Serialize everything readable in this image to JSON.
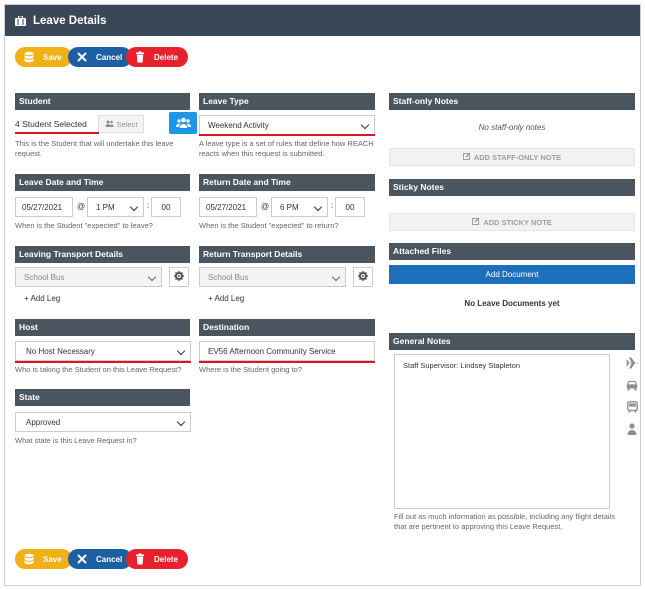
{
  "window": {
    "title": "Leave Details"
  },
  "actions": {
    "save": "Save",
    "cancel": "Cancel",
    "delete": "Delete"
  },
  "student": {
    "header": "Student",
    "value": "4 Student Selected",
    "select_label": "Select",
    "hint": "This is the Student that will undertake this leave request."
  },
  "leave_type": {
    "header": "Leave Type",
    "value": "Weekend Activity",
    "hint": "A leave type is a set of rules that define how REACH reacts when this request is submitted."
  },
  "leave_datetime": {
    "header": "Leave Date and Time",
    "date": "05/27/2021",
    "at": "@",
    "hour": "1 PM",
    "sep": ":",
    "minute": "00",
    "hint": "When is the Student \"expected\" to leave?"
  },
  "return_datetime": {
    "header": "Return Date and Time",
    "date": "05/27/2021",
    "at": "@",
    "hour": "6 PM",
    "sep": ":",
    "minute": "00",
    "hint": "When is the Student \"expected\" to return?"
  },
  "leaving_transport": {
    "header": "Leaving Transport Details",
    "value": "School Bus",
    "add_leg": "+ Add Leg"
  },
  "return_transport": {
    "header": "Return Transport Details",
    "value": "School Bus",
    "add_leg": "+ Add Leg"
  },
  "host": {
    "header": "Host",
    "value": "No Host Necessary",
    "hint": "Who is taking the Student on this Leave Request?"
  },
  "destination": {
    "header": "Destination",
    "value": "EV56 Afternoon Community Service",
    "hint": "Where is the Student going to?"
  },
  "state": {
    "header": "State",
    "value": "Approved",
    "hint": "What state is this Leave Request in?"
  },
  "staff_notes": {
    "header": "Staff-only Notes",
    "empty": "No staff-only notes",
    "add": "ADD STAFF-ONLY NOTE"
  },
  "sticky_notes": {
    "header": "Sticky Notes",
    "add": "ADD STICKY NOTE"
  },
  "attached_files": {
    "header": "Attached Files",
    "add": "Add Document",
    "empty": "No Leave Documents yet"
  },
  "general_notes": {
    "header": "General Notes",
    "content": "Staff Supervisor: Lindsey Stapleton",
    "hint": "Fill out as much information as possible, including any flight details that are pertinent to approving this Leave Request."
  },
  "side_icons": [
    "plane-icon",
    "car-icon",
    "bus-icon",
    "person-icon"
  ],
  "colors": {
    "header_bg": "#4a5560",
    "titlebar_bg": "#3a4757",
    "save": "#f2b017",
    "cancel": "#1c5fa3",
    "delete": "#e8212f",
    "accent_blue": "#1e6fba",
    "annotation_red": "#e0141e"
  }
}
